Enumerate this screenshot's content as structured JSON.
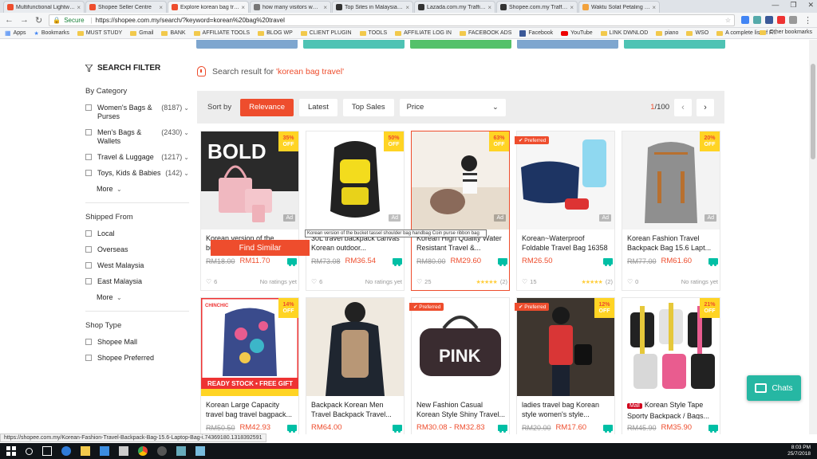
{
  "browser": {
    "tabs": [
      {
        "title": "Multifunctional Lightwe...",
        "color": "#ee4d2d"
      },
      {
        "title": "Shopee Seller Centre",
        "color": "#ee4d2d"
      },
      {
        "title": "Explore korean bag trav...",
        "color": "#ee4d2d",
        "active": true
      },
      {
        "title": "how many visitors www...",
        "color": "#777"
      },
      {
        "title": "Top Sites in Malaysia - A...",
        "color": "#333"
      },
      {
        "title": "Lazada.com.my Traffic, D...",
        "color": "#333"
      },
      {
        "title": "Shopee.com.my Traffic, D...",
        "color": "#333"
      },
      {
        "title": "Waktu Solat Petaling 201...",
        "color": "#f2a23c"
      }
    ],
    "address": {
      "secure_label": "Secure",
      "url": "https://shopee.com.my/search/?keyword=korean%20bag%20travel"
    },
    "bookmarks": [
      "Apps",
      "Bookmarks",
      "MUST STUDY",
      "Gmail",
      "BANK",
      "AFFILIATE TOOLS",
      "BLOG WP",
      "CLIENT PLUGIN",
      "TOOLS",
      "AFFILIATE LOG IN",
      "FACEBOOK ADS",
      "Facebook",
      "YouTube",
      "LINK DWNLOD",
      "piano",
      "WSO",
      "A complete list of F..."
    ],
    "other_bookmarks": "Other bookmarks"
  },
  "sidebar": {
    "title": "SEARCH FILTER",
    "by_category": {
      "heading": "By Category",
      "items": [
        {
          "label": "Women's Bags & Purses",
          "count": "(8187)"
        },
        {
          "label": "Men's Bags & Wallets",
          "count": "(2430)"
        },
        {
          "label": "Travel & Luggage",
          "count": "(1217)"
        },
        {
          "label": "Toys, Kids & Babies",
          "count": "(142)"
        }
      ],
      "more": "More"
    },
    "shipped_from": {
      "heading": "Shipped From",
      "items": [
        "Local",
        "Overseas",
        "West Malaysia",
        "East Malaysia"
      ],
      "more": "More"
    },
    "shop_type": {
      "heading": "Shop Type",
      "items": [
        "Shopee Mall",
        "Shopee Preferred"
      ]
    }
  },
  "results": {
    "prefix": "Search result for ",
    "keyword": "'korean bag travel'"
  },
  "sortbar": {
    "label": "Sort by",
    "options": [
      "Relevance",
      "Latest",
      "Top Sales"
    ],
    "price": "Price",
    "page_current": "1",
    "page_total": "/100"
  },
  "products": [
    {
      "name": "Korean version of the bucket tassel shoulder...",
      "old": "RM18.00",
      "price": "RM11.70",
      "discount": "35%",
      "likes": "6",
      "rating": "No ratings yet",
      "ad": true,
      "img": "pink"
    },
    {
      "name": "30L travel backpack canvas Korean outdoor...",
      "old": "RM73.08",
      "price": "RM36.54",
      "discount": "50%",
      "likes": "6",
      "rating": "No ratings yet",
      "ad": true,
      "img": "yellow"
    },
    {
      "name": "Korean High Quality Water Resistant Travel &...",
      "old": "RM80.00",
      "price": "RM29.60",
      "discount": "63%",
      "likes": "25",
      "rating": "(2)",
      "stars": true,
      "ad": true,
      "img": "girl",
      "hover": true
    },
    {
      "name": "Korean~Waterproof Foldable Travel Bag 16358",
      "old": "",
      "price": "RM26.50",
      "discount": "",
      "likes": "15",
      "rating": "(2)",
      "stars": true,
      "ad": true,
      "preferred": true,
      "img": "navy"
    },
    {
      "name": "Korean Fashion Travel Backpack Bag 15.6 Lapt...",
      "old": "RM77.00",
      "price": "RM61.60",
      "discount": "20%",
      "likes": "0",
      "rating": "No ratings yet",
      "ad": true,
      "img": "grey"
    },
    {
      "name": "Korean Large Capacity travel bag travel bagpack...",
      "old": "RM50.50",
      "price": "RM42.93",
      "discount": "14%",
      "img": "floral"
    },
    {
      "name": "Backpack Korean Men Travel Backpack Travel...",
      "old": "",
      "price": "RM64.00",
      "discount": "",
      "img": "man"
    },
    {
      "name": "New Fashion Casual Korean Style Shiny Travel...",
      "old": "",
      "price": "RM30.08 - RM32.83",
      "discount": "",
      "preferred": true,
      "img": "pinkbag"
    },
    {
      "name": "ladies travel bag Korean style women's style...",
      "old": "RM20.00",
      "price": "RM17.60",
      "discount": "12%",
      "preferred": true,
      "img": "red"
    },
    {
      "name": "Korean Style Tape Sporty Backpack / Bags...",
      "old": "RM45.90",
      "price": "RM35.90",
      "discount": "21%",
      "mall": true,
      "img": "tape"
    }
  ],
  "labels": {
    "ad": "Ad",
    "off": "OFF",
    "preferred": "Preferred",
    "mall": "Mall",
    "find_similar": "Find Similar",
    "tooltip": "Korean version of the bucket tassel shoulder bag handbag Coin purse ribbon bag",
    "chats": "Chats",
    "image_words": {
      "bold": "BOLD",
      "pink": "PINK",
      "ready_stock": "READY STOCK • FREE GIFT",
      "chinchic": "CHINCHIC"
    }
  },
  "status_url": "https://shopee.com.my/Korean-Fashion-Travel-Backpack-Bag-15.6-Laptop-Bag-i.74369180.1318392591",
  "taskbar": {
    "time": "8:03 PM",
    "date": "25/7/2018"
  },
  "colors": {
    "brand": "#ee4d2d",
    "badge": "#ffd424",
    "chat": "#26b7a3"
  }
}
